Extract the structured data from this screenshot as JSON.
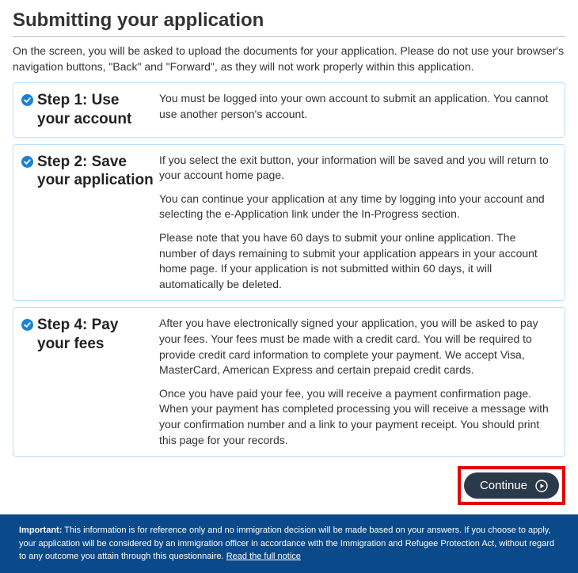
{
  "title": "Submitting your application",
  "intro": "On the screen, you will be asked to upload the documents for your application. Please do not use your browser's navigation buttons, \"Back\" and \"Forward\", as they will not work properly within this application.",
  "steps": [
    {
      "heading": "Step 1: Use your account",
      "paragraphs": [
        "You must be logged into your own account to submit an application. You cannot use another person's account."
      ]
    },
    {
      "heading": "Step 2: Save your application",
      "paragraphs": [
        "If you select the exit button, your information will be saved and you will return to your account home page.",
        "You can continue your application at any time by logging into your account and selecting the e-Application link under the In-Progress section.",
        "Please note that you have 60 days to submit your online application. The number of days remaining to submit your application appears in your account home page. If your application is not submitted within 60 days, it will automatically be deleted."
      ]
    },
    {
      "heading": "Step 4: Pay your fees",
      "paragraphs": [
        "After you have electronically signed your application, you will be asked to pay your fees. Your fees must be made with a credit card. You will be required to provide credit card information to complete your payment. We accept Visa, MasterCard, American Express and certain prepaid credit cards.",
        "Once you have paid your fee, you will receive a payment confirmation page.  When your payment has completed processing  you will receive a message with your confirmation number and a link to your payment receipt.  You should print this page for your records."
      ]
    }
  ],
  "continue_label": "Continue",
  "footer": {
    "important_label": "Important:",
    "text": "This information is for reference only and no immigration decision will be made based on your answers. If you choose to apply, your application will be considered by an immigration officer in accordance with the Immigration and Refugee Protection Act, without regard to any outcome you attain through this questionnaire.",
    "link_text": "Read the full notice"
  }
}
